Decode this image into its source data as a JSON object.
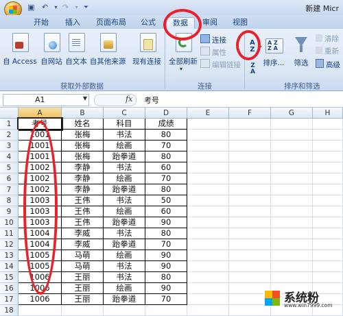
{
  "window": {
    "title": "新建 Micr"
  },
  "tabs": [
    "开始",
    "插入",
    "页面布局",
    "公式",
    "数据",
    "审阅",
    "视图"
  ],
  "ribbon": {
    "get_external": {
      "buttons": [
        "自 Access",
        "自网站",
        "自文本",
        "自其他来源",
        "现有连接"
      ],
      "group_label": "获取外部数据"
    },
    "connections": {
      "refresh_all": "全部刷新",
      "connections": "连接",
      "properties": "属性",
      "edit_links": "编辑链接",
      "group_label": "连接"
    },
    "sort_filter": {
      "sort": "排序...",
      "filter": "筛选",
      "clear": "清除",
      "reapply": "重新",
      "advanced": "高级",
      "group_label": "排序和筛选"
    }
  },
  "formula_bar": {
    "name_box": "A1",
    "fx": "fx",
    "value": "考号"
  },
  "grid": {
    "columns": [
      "A",
      "B",
      "C",
      "D",
      "E",
      "F",
      "G",
      "H"
    ],
    "headers": [
      "考号",
      "姓名",
      "科目",
      "成绩"
    ],
    "rows": [
      [
        "1001",
        "张梅",
        "书法",
        "80"
      ],
      [
        "1001",
        "张梅",
        "绘画",
        "70"
      ],
      [
        "1001",
        "张梅",
        "跆拳道",
        "80"
      ],
      [
        "1002",
        "李静",
        "书法",
        "60"
      ],
      [
        "1002",
        "李静",
        "绘画",
        "70"
      ],
      [
        "1002",
        "李静",
        "跆拳道",
        "80"
      ],
      [
        "1003",
        "王伟",
        "书法",
        "50"
      ],
      [
        "1003",
        "王伟",
        "绘画",
        "60"
      ],
      [
        "1003",
        "王伟",
        "跆拳道",
        "90"
      ],
      [
        "1004",
        "李威",
        "书法",
        "80"
      ],
      [
        "1004",
        "李威",
        "跆拳道",
        "70"
      ],
      [
        "1005",
        "马萌",
        "绘画",
        "90"
      ],
      [
        "1005",
        "马萌",
        "书法",
        "90"
      ],
      [
        "1006",
        "王丽",
        "书法",
        "80"
      ],
      [
        "1006",
        "王丽",
        "绘画",
        "90"
      ],
      [
        "1006",
        "王丽",
        "跆拳道",
        "70"
      ]
    ]
  },
  "watermark": {
    "text": "系统粉",
    "url": "www.win7999.com"
  },
  "annotation_color": "#e8222b"
}
